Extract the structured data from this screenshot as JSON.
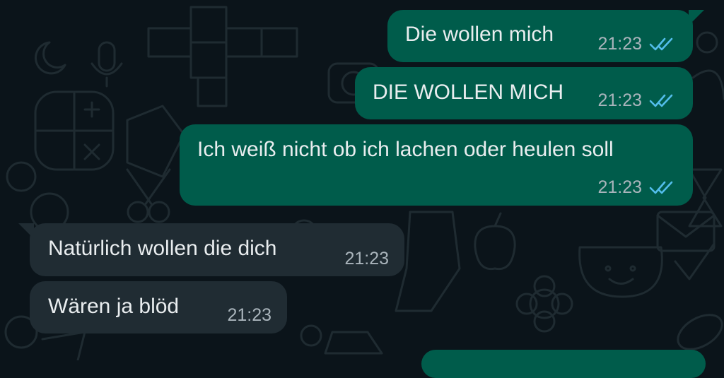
{
  "chat": {
    "colors": {
      "background": "#0b141a",
      "outgoing_bubble": "#005c4b",
      "incoming_bubble": "#202c33",
      "text": "#e9edef",
      "timestamp": "#a9b4bb",
      "read_ticks": "#53bdeb"
    },
    "messages": [
      {
        "direction": "outgoing",
        "text": "Die wollen mich",
        "time": "21:23",
        "status_icon": "double-check-read-icon"
      },
      {
        "direction": "outgoing",
        "text": "DIE WOLLEN MICH",
        "time": "21:23",
        "status_icon": "double-check-read-icon"
      },
      {
        "direction": "outgoing",
        "text": "Ich weiß nicht ob ich lachen oder heulen soll",
        "time": "21:23",
        "status_icon": "double-check-read-icon"
      },
      {
        "direction": "incoming",
        "text": "Natürlich wollen die dich",
        "time": "21:23"
      },
      {
        "direction": "incoming",
        "text": "Wären ja blöd",
        "time": "21:23"
      }
    ]
  }
}
